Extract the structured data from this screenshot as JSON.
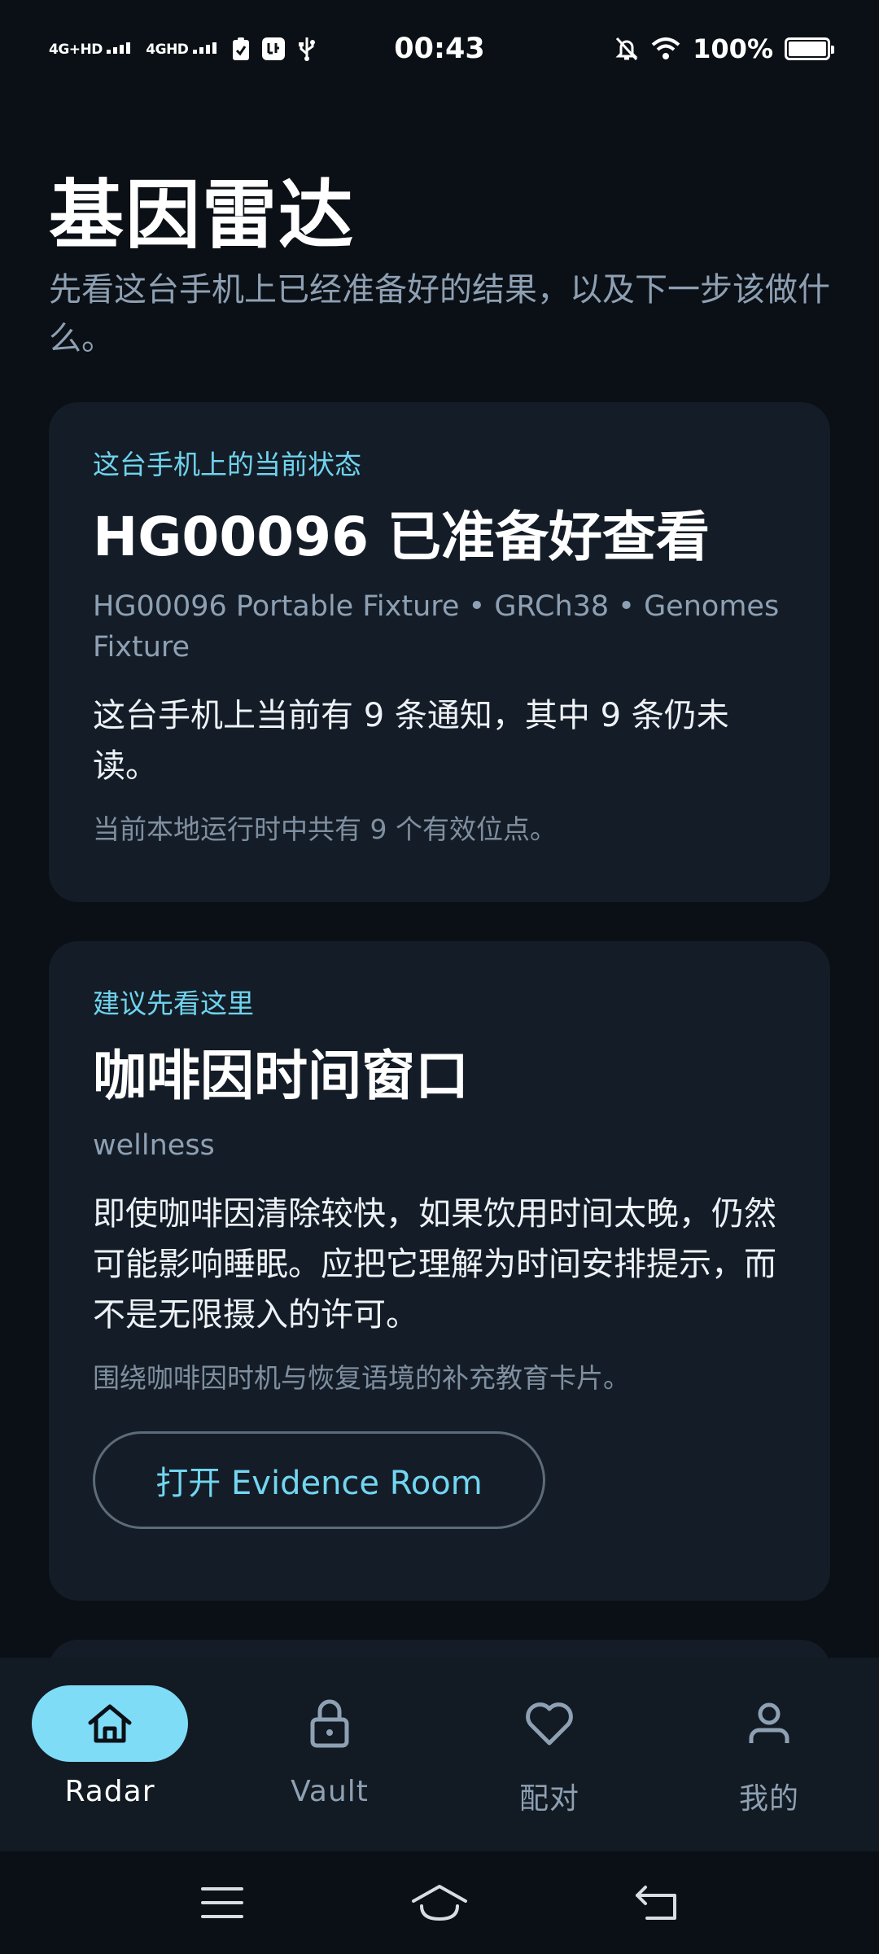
{
  "status_bar": {
    "network_1": "4G+HD",
    "network_2": "4GHD",
    "time": "00:43",
    "battery_text": "100%",
    "battery_level": 1.0
  },
  "header": {
    "title": "基因雷达",
    "subtitle": "先看这台手机上已经准备好的结果，以及下一步该做什么。"
  },
  "status_card": {
    "eyebrow": "这台手机上的当前状态",
    "title": "HG00096 已准备好查看",
    "meta": "HG00096 Portable Fixture  •  GRCh38  •  Genomes Fixture",
    "body": "这台手机上当前有 9 条通知，其中 9 条仍未读。",
    "note": "当前本地运行时中共有 9 个有效位点。"
  },
  "suggestion_card": {
    "eyebrow": "建议先看这里",
    "title": "咖啡因时间窗口",
    "category": "wellness",
    "body": "即使咖啡因清除较快，如果饮用时间太晚，仍然可能影响睡眠。应把它理解为时间安排提示，而不是无限摄入的许可。",
    "note": "围绕咖啡因时机与恢复语境的补充教育卡片。",
    "button_label": "打开 Evidence Room"
  },
  "bottom_nav": {
    "items": [
      {
        "label": "Radar",
        "icon": "home-icon",
        "active": true
      },
      {
        "label": "Vault",
        "icon": "lock-icon",
        "active": false
      },
      {
        "label": "配对",
        "icon": "heart-icon",
        "active": false
      },
      {
        "label": "我的",
        "icon": "person-icon",
        "active": false
      }
    ]
  },
  "colors": {
    "background": "#0b1016",
    "card": "#141d27",
    "accent": "#6fd3ee",
    "active_nav": "#7fdcf7",
    "muted_text": "#8ea0b3"
  }
}
